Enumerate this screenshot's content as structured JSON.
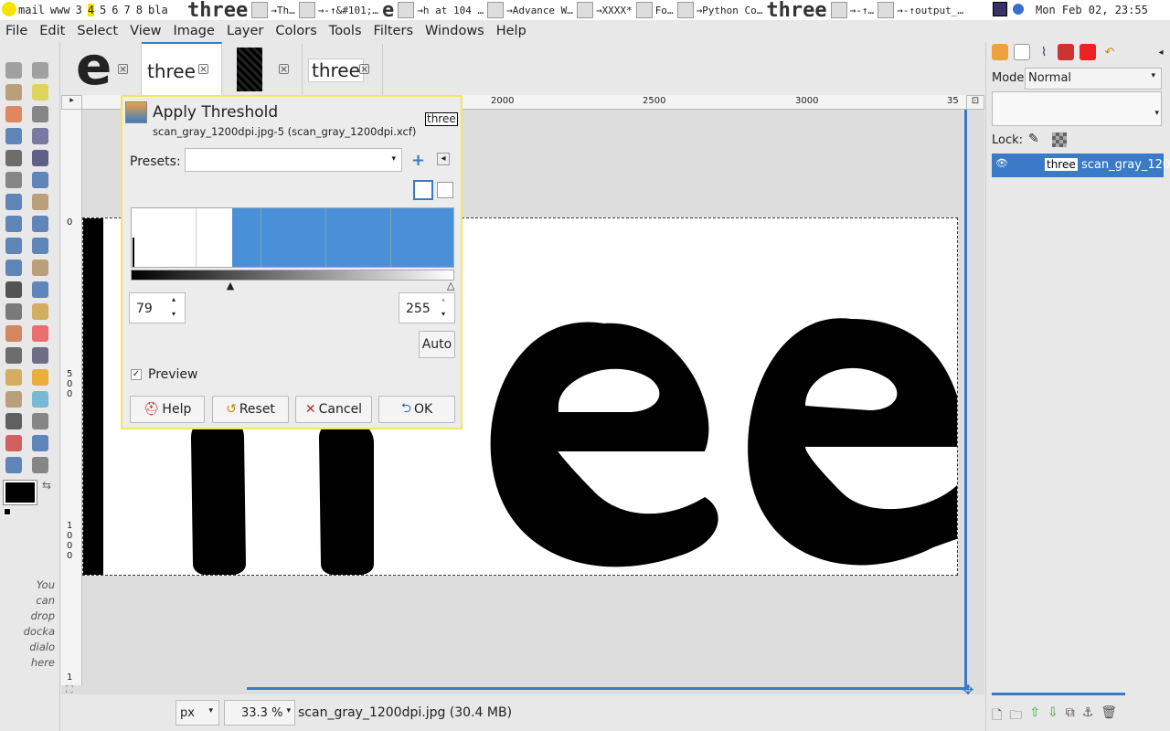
{
  "topbar": {
    "workspaces": [
      "mail",
      "www",
      "3",
      "4",
      "5",
      "6",
      "7",
      "8",
      "bla"
    ],
    "active_workspace": "4",
    "windows": [
      {
        "label": "three",
        "big": true
      },
      {
        "label": "→Th…"
      },
      {
        "label": "→-↑&#101;…"
      },
      {
        "label": "e",
        "big": true
      },
      {
        "label": "→h at 104 …"
      },
      {
        "label": "→Advance W…"
      },
      {
        "label": "→XXXX*"
      },
      {
        "label": "Fo…"
      },
      {
        "label": "→Python Co…"
      },
      {
        "label": "three",
        "big": true
      },
      {
        "label": "→-↑…"
      },
      {
        "label": "→-↑output_…"
      }
    ],
    "clock": "Mon Feb 02, 23:55"
  },
  "menu": [
    "File",
    "Edit",
    "Select",
    "View",
    "Image",
    "Layer",
    "Colors",
    "Tools",
    "Filters",
    "Windows",
    "Help"
  ],
  "tabs": [
    {
      "label": "e"
    },
    {
      "label": "three"
    },
    {
      "label": ""
    },
    {
      "label": "three"
    }
  ],
  "ruler": {
    "top": [
      "2000",
      "2500",
      "3000",
      "35"
    ],
    "left": [
      "0",
      "5\n0\n0",
      "1\n0\n0\n0",
      "1"
    ]
  },
  "image_text": "three",
  "toolbox_hint": [
    "You",
    "can",
    "drop",
    "docka",
    "dialo",
    "here"
  ],
  "status": {
    "unit": "px",
    "zoom": "33.3 %",
    "filename": "scan_gray_1200dpi.jpg (30.4 MB)"
  },
  "dock": {
    "mode_label": "Mode:",
    "mode_value": "Normal",
    "lock_label": "Lock:",
    "layer_thumb_text": "three",
    "layer_name": "scan_gray_120"
  },
  "dialog": {
    "title": "Apply Threshold",
    "subtitle": "scan_gray_1200dpi.jpg-5 (scan_gray_1200dpi.xcf)",
    "thumb_text": "three",
    "presets_label": "Presets:",
    "presets_value": "",
    "low_value": "79",
    "high_value": "255",
    "low_fraction": 0.31,
    "auto_label": "Auto",
    "preview_label": "Preview",
    "preview_checked": true,
    "buttons": {
      "help": "Help",
      "reset": "Reset",
      "cancel": "Cancel",
      "ok": "OK"
    }
  },
  "colors": {
    "accent": "#3b7ac6",
    "histogram_fill": "#4a90d9",
    "dialog_border": "#f2e65c",
    "foreground": "#000000"
  }
}
